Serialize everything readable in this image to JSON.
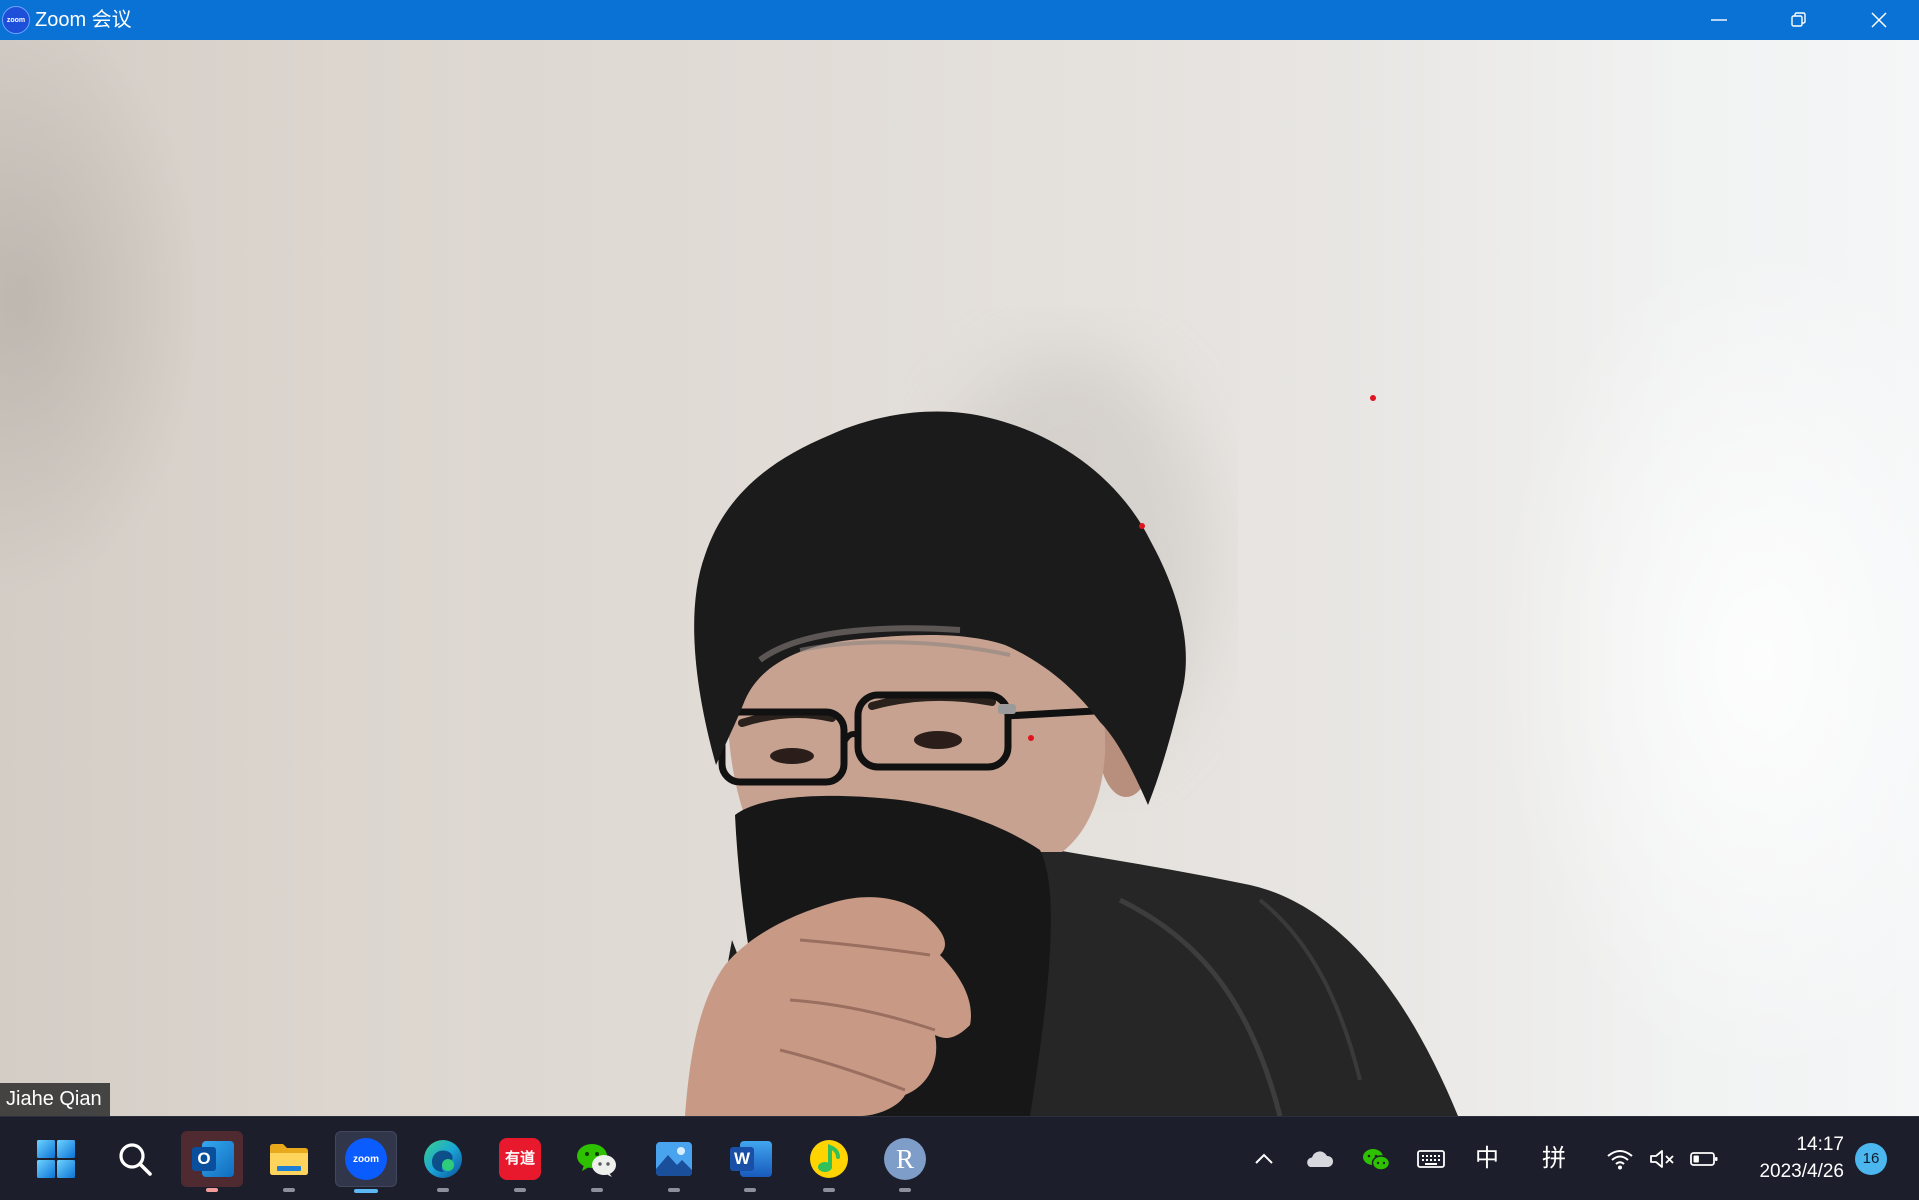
{
  "window": {
    "title": "Zoom 会议",
    "logo_text": "zoom",
    "accent_color": "#0a72d4",
    "controls": [
      "minimize",
      "restore",
      "close"
    ]
  },
  "meeting": {
    "participant_name": "Jiahe Qian"
  },
  "taskbar": {
    "apps": [
      {
        "id": "start",
        "icon": "windows-start-icon"
      },
      {
        "id": "search",
        "icon": "search-icon"
      },
      {
        "id": "outlook",
        "icon": "outlook-icon",
        "glyph": "O"
      },
      {
        "id": "file-explorer",
        "icon": "folder-icon"
      },
      {
        "id": "zoom",
        "icon": "zoom-icon",
        "glyph": "zoom"
      },
      {
        "id": "edge",
        "icon": "edge-icon"
      },
      {
        "id": "youdao",
        "icon": "youdao-icon",
        "glyph": "有道"
      },
      {
        "id": "wechat",
        "icon": "wechat-icon"
      },
      {
        "id": "photos",
        "icon": "photos-icon"
      },
      {
        "id": "word",
        "icon": "word-icon",
        "glyph": "W"
      },
      {
        "id": "qq-music",
        "icon": "qq-music-icon"
      },
      {
        "id": "r",
        "icon": "r-icon",
        "glyph": "R"
      }
    ],
    "tray": {
      "icons": [
        "chevron-up-icon",
        "onedrive-cloud-icon",
        "wechat-icon",
        "keyboard-icon",
        "wifi-icon",
        "speaker-muted-icon",
        "battery-icon"
      ],
      "ime_language": "中",
      "ime_mode": "拼",
      "battery_level": 0.3
    },
    "clock": {
      "time": "14:17",
      "date": "2023/4/26"
    },
    "notification_count": "16"
  }
}
